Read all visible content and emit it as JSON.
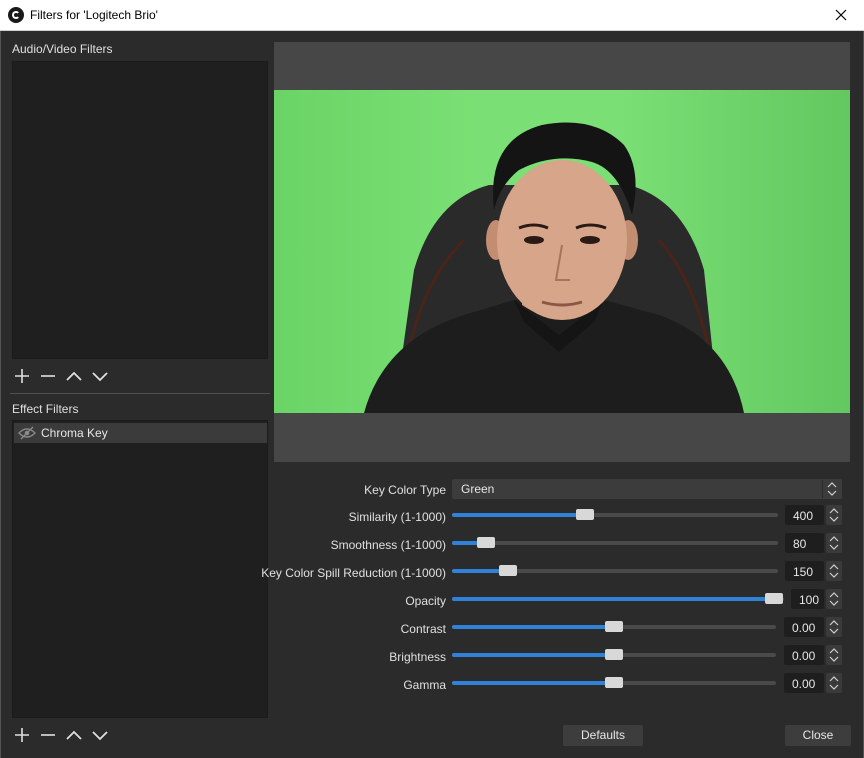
{
  "window": {
    "title": "Filters for 'Logitech Brio'",
    "close_glyph": "✕"
  },
  "left": {
    "av_filters_label": "Audio/Video Filters",
    "effect_filters_label": "Effect Filters",
    "effect_filters": [
      {
        "label": "Chroma Key",
        "icon": "eye-hidden-icon"
      }
    ]
  },
  "properties": {
    "key_color_type": {
      "label": "Key Color Type",
      "value": "Green"
    },
    "sliders": [
      {
        "label": "Similarity (1-1000)",
        "value": "400",
        "fraction": 0.4
      },
      {
        "label": "Smoothness (1-1000)",
        "value": "80",
        "fraction": 0.1
      },
      {
        "label": "Key Color Spill Reduction (1-1000)",
        "value": "150",
        "fraction": 0.17
      },
      {
        "label": "Opacity",
        "value": "100",
        "fraction": 1.0
      },
      {
        "label": "Contrast",
        "value": "0.00",
        "fraction": 0.5
      },
      {
        "label": "Brightness",
        "value": "0.00",
        "fraction": 0.5
      },
      {
        "label": "Gamma",
        "value": "0.00",
        "fraction": 0.5
      }
    ]
  },
  "buttons": {
    "defaults": "Defaults",
    "close": "Close"
  },
  "colors": {
    "accent": "#2f82d8",
    "chroma_green": "#7ae075",
    "background": "#2b2b2b"
  }
}
